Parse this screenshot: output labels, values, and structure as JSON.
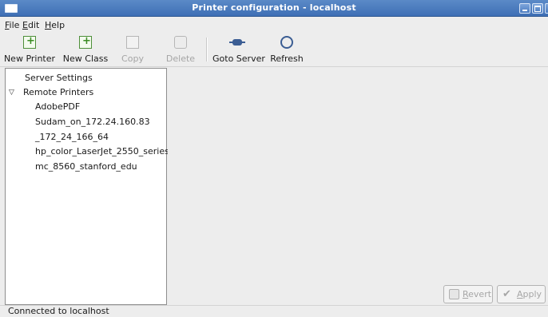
{
  "window": {
    "title": "Printer configuration - localhost"
  },
  "menubar": {
    "file": {
      "mnemonic": "F",
      "rest": "ile"
    },
    "edit": {
      "mnemonic": "E",
      "rest": "dit"
    },
    "help": {
      "mnemonic": "H",
      "rest": "elp"
    }
  },
  "toolbar": {
    "new_printer": {
      "label": "New Printer",
      "icon": "new-printer-icon",
      "enabled": true
    },
    "new_class": {
      "label": "New Class",
      "icon": "new-class-icon",
      "enabled": true
    },
    "copy": {
      "label": "Copy",
      "icon": "copy-icon",
      "enabled": false
    },
    "delete": {
      "label": "Delete",
      "icon": "delete-icon",
      "enabled": false
    },
    "goto_server": {
      "label": "Goto Server",
      "icon": "server-connect-icon",
      "enabled": true
    },
    "refresh": {
      "label": "Refresh",
      "icon": "refresh-icon",
      "enabled": true
    }
  },
  "tree": {
    "server_settings": "Server Settings",
    "remote_printers": {
      "label": "Remote Printers",
      "expanded": true,
      "children": [
        "AdobePDF",
        "Sudam_on_172.24.160.83",
        "_172_24_166_64",
        "hp_color_LaserJet_2550_series",
        "mc_8560_stanford_edu"
      ]
    }
  },
  "buttons": {
    "revert": {
      "mnemonic": "R",
      "rest": "evert",
      "enabled": false
    },
    "apply": {
      "mnemonic": "A",
      "rest": "pply",
      "enabled": false
    }
  },
  "statusbar": {
    "text": "Connected to localhost"
  },
  "colors": {
    "titlebar": "#4a7bbd",
    "window_bg": "#ededed",
    "disabled_text": "#a5a5a5"
  }
}
